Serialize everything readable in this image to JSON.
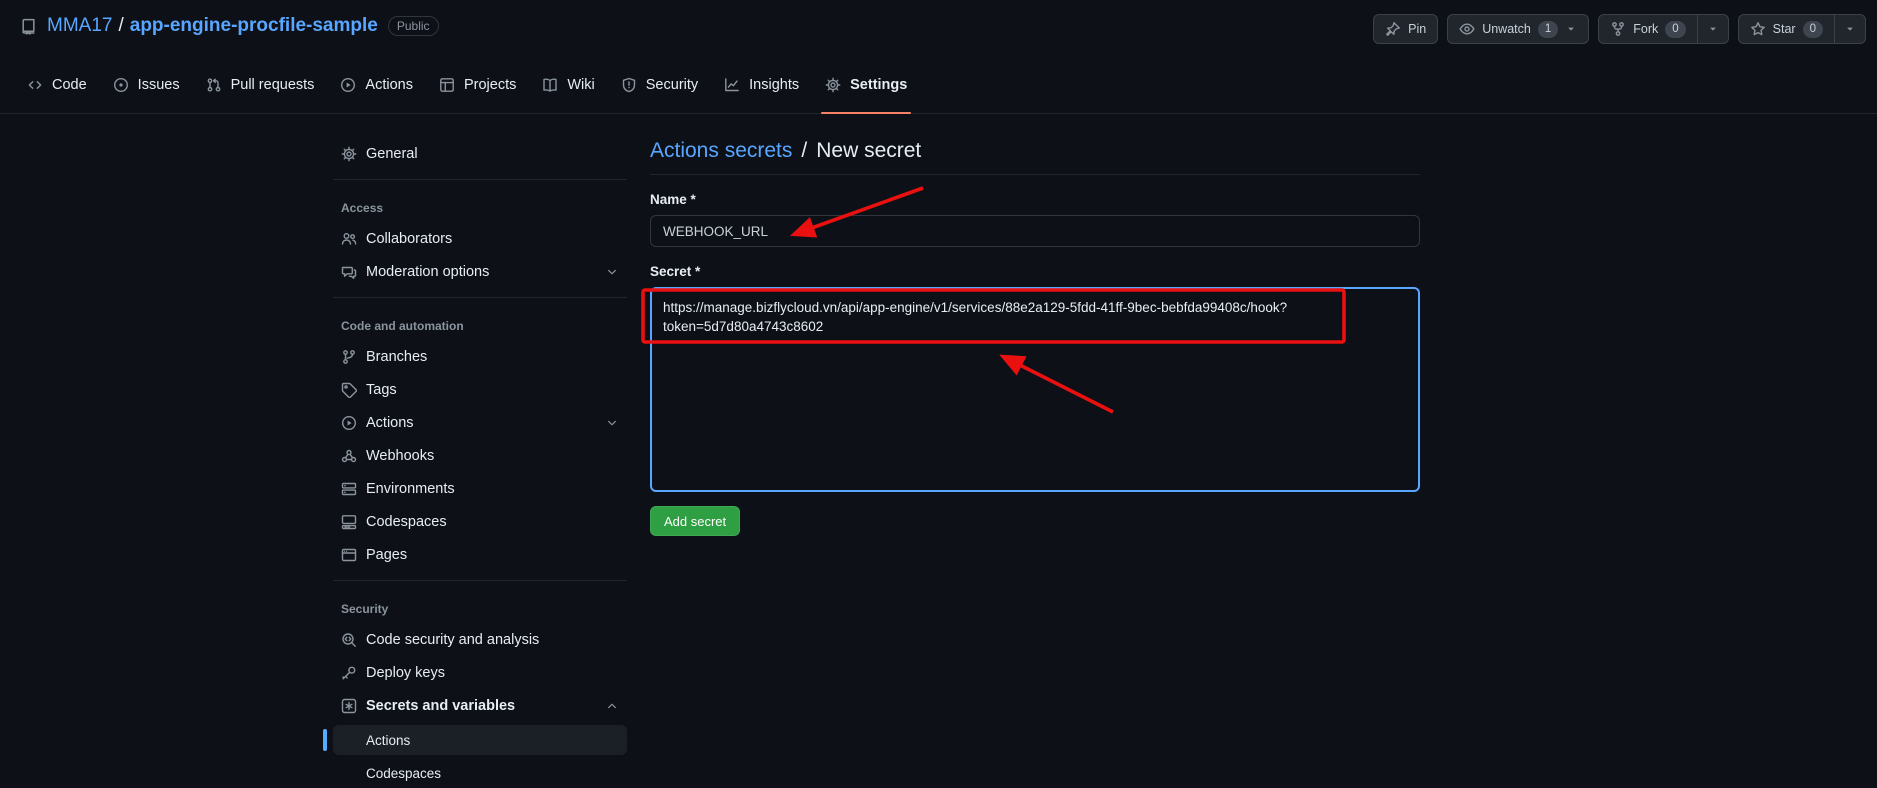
{
  "header": {
    "repo_owner": "MMA17",
    "separator": "/",
    "repo_name": "app-engine-procfile-sample",
    "visibility_badge": "Public",
    "actions": {
      "pin_label": "Pin",
      "unwatch_label": "Unwatch",
      "unwatch_count": "1",
      "fork_label": "Fork",
      "fork_count": "0",
      "star_label": "Star",
      "star_count": "0"
    }
  },
  "tabs": [
    {
      "label": "Code",
      "icon": "code-icon"
    },
    {
      "label": "Issues",
      "icon": "issue-icon"
    },
    {
      "label": "Pull requests",
      "icon": "pull-request-icon"
    },
    {
      "label": "Actions",
      "icon": "play-icon"
    },
    {
      "label": "Projects",
      "icon": "project-icon"
    },
    {
      "label": "Wiki",
      "icon": "book-icon"
    },
    {
      "label": "Security",
      "icon": "shield-icon"
    },
    {
      "label": "Insights",
      "icon": "graph-icon"
    },
    {
      "label": "Settings",
      "icon": "gear-icon",
      "active": true
    }
  ],
  "sidebar": {
    "general": {
      "label": "General",
      "icon": "gear-icon"
    },
    "sections": [
      {
        "title": "Access",
        "items": [
          {
            "label": "Collaborators",
            "icon": "people-icon"
          },
          {
            "label": "Moderation options",
            "icon": "comment-discussion-icon",
            "chevron": "down"
          }
        ]
      },
      {
        "title": "Code and automation",
        "items": [
          {
            "label": "Branches",
            "icon": "git-branch-icon"
          },
          {
            "label": "Tags",
            "icon": "tag-icon"
          },
          {
            "label": "Actions",
            "icon": "play-icon",
            "chevron": "down"
          },
          {
            "label": "Webhooks",
            "icon": "webhook-icon"
          },
          {
            "label": "Environments",
            "icon": "server-icon"
          },
          {
            "label": "Codespaces",
            "icon": "codespaces-icon"
          },
          {
            "label": "Pages",
            "icon": "browser-icon"
          }
        ]
      },
      {
        "title": "Security",
        "items": [
          {
            "label": "Code security and analysis",
            "icon": "codescan-icon"
          },
          {
            "label": "Deploy keys",
            "icon": "key-icon"
          },
          {
            "label": "Secrets and variables",
            "icon": "secret-icon",
            "chevron": "up",
            "expanded": true,
            "subitems": [
              {
                "label": "Actions",
                "active": true
              },
              {
                "label": "Codespaces",
                "active": false
              }
            ]
          }
        ]
      }
    ]
  },
  "main": {
    "breadcrumb": {
      "link": "Actions secrets",
      "separator": "/",
      "current": "New secret"
    },
    "form": {
      "name_label": "Name *",
      "name_value": "WEBHOOK_URL",
      "secret_label": "Secret *",
      "secret_value": "https://manage.bizflycloud.vn/api/app-engine/v1/services/88e2a129-5fdd-41ff-9bec-bebfda99408c/hook?token=5d7d80a4743c8602",
      "submit_label": "Add secret"
    }
  },
  "colors": {
    "accent_link": "#58a6ff",
    "tab_underline": "#f78166",
    "button_green": "#2ea043",
    "annotation_red": "#ea1010",
    "sidebar_active_bar": "#54aeff",
    "focus_border": "#58a6ff"
  }
}
